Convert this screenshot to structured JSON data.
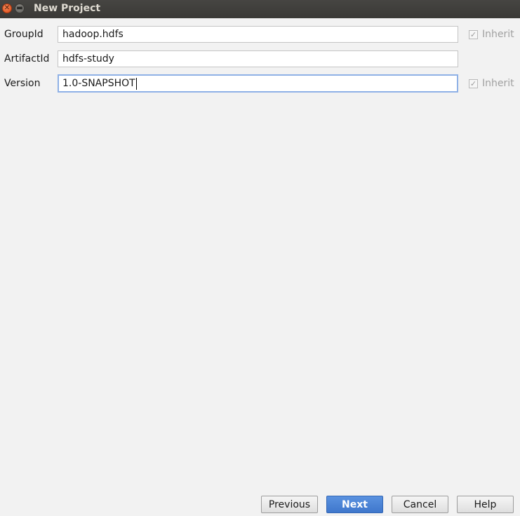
{
  "window": {
    "title": "New Project"
  },
  "form": {
    "group_id": {
      "label": "GroupId",
      "value": "hadoop.hdfs",
      "inherit_label": "Inherit",
      "inherit_checked": true
    },
    "artifact_id": {
      "label": "ArtifactId",
      "value": "hdfs-study"
    },
    "version": {
      "label": "Version",
      "value": "1.0-SNAPSHOT",
      "inherit_label": "Inherit",
      "inherit_checked": true
    }
  },
  "buttons": {
    "previous": "Previous",
    "next": "Next",
    "cancel": "Cancel",
    "help": "Help"
  },
  "icons": {
    "close": "close-icon",
    "minimize": "minimize-icon",
    "checkbox_mark": "✓"
  },
  "colors": {
    "accent": "#4a86d8",
    "titlebar": "#3f3e3b",
    "focus_ring": "#8fb1e6"
  }
}
